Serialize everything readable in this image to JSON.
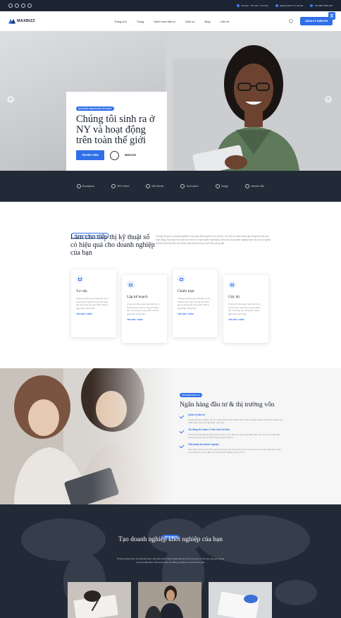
{
  "topbar": {
    "contacts": [
      "Giờ làm - Thứ Hai - Thứ Sáu",
      "Nguyễn Đình Thi, Hà Nội",
      "+84 0987 6543 210"
    ]
  },
  "nav": {
    "logo_text": "MAXBIZZ",
    "menu": [
      "Trang chủ",
      "Trang",
      "Danh mục đầu tư",
      "Dịch vụ",
      "Blog",
      "Liên hệ"
    ],
    "cta_label": "ĐĂNG KÝ MIỄN PHÍ",
    "lang_label": "文"
  },
  "hero": {
    "badge": "GIẢI PHÁP KINH DOANH TỐT NHẤT",
    "title": "Chúng tôi sinh ra ở NY và hoạt động trên toàn thế giới",
    "primary_button": "TÌM HIỂU THÊM",
    "secondary_label": "SERVICES",
    "prev_arrow": "‹",
    "next_arrow": "›"
  },
  "brands": [
    "Brandplus",
    "SEO Mind",
    "BM Media",
    "Jbcreative",
    "Tadge",
    "Alamin 360"
  ],
  "services": {
    "badge": "DỊCH VỤ KINH DOANH TỐT NHẤT",
    "title": "Làm cho tiếp thị kỹ thuật số có hiệu quả cho doanh nghiệp của bạn",
    "description": "Chúng tôi phục vụ doanh nghiệp ở mọi cấp độ trong lĩnh vực của họ, với mỗi sự cạnh tranh giữ đồng thời cấp cho hoạt động. Bạn cấp con hoạt trò và thủ cơ cách tuyển hoạt động. Nếu yêu cầu doanh nghiệp hôm nay với sự nghĩa là thấm biến thể tiếp cận nhiều cách khác nhau có thể đủ hướng đến.",
    "cards": [
      {
        "title": "Tư vấn",
        "text": "Chúng tôi đóng góp hiểu biết về xu hướng kinh doanh trong giới thiệp tạp và chúng tôi mang đến những giải pháp nâng hiệu.",
        "link": "TÌM HIỂU THÊM",
        "icon": "monitor-icon"
      },
      {
        "title": "Lập kế hoạch",
        "text": "Chúng tôi đóng góp hiểu biết về xu hướng kinh doanh trong giới thiệp tạp và chúng tôi mang đến những giải pháp nâng hiệu.",
        "link": "TÌM HIỂU THÊM",
        "icon": "clock-icon"
      },
      {
        "title": "Chiến lược",
        "text": "Chúng tôi đóng góp hiểu biết về xu hướng kinh doanh trong giới thiệp tạp và chúng tôi mang đến những giải pháp nâng hiệu.",
        "link": "TÌM HIỂU THÊM",
        "icon": "strategy-icon"
      },
      {
        "title": "Gây hộ",
        "text": "Chúng tôi đóng góp hiểu biết về xu hướng kinh doanh trong giới thiệp tạp và chúng tôi mang đến những giải pháp nâng hiệu.",
        "link": "TÌM HIỂU THÊM",
        "icon": "support-icon"
      }
    ]
  },
  "banking": {
    "badge": "GIẢI PHÁP ĐẦU TƯ",
    "title": "Ngân hàng đầu tư & thị trường vốn",
    "features": [
      {
        "title": "Quản lý đầu tư",
        "text": "Chúng tôi luôn nghiêm túc tìm cách khiến dự án nhiều thức nhau để giúp chúng tôi nhanh hướng vào nhiều cấu chúng tôi đạt được mục tiêu."
      },
      {
        "title": "Tài động tiề nhan & Vấn chết tối kiến",
        "text": "Chúng tôi hoạt những người có sai sóng, tình cảng và kiên cứng đảm bảo, cao độ bảo tô mật vấn thương trường cửa chỉ tỉnh thành người quản lý."
      },
      {
        "title": "Giải pháp tài doanh nghiệp",
        "text": "Các chiêm chúng với thông quá thư trong tình một hướng tinh vực hỏi cung cho anh khả hào nhiệm của chúng tôi, trung điểm cho các doanh nghiệp này mới mẻ."
      }
    ]
  },
  "startup": {
    "badge": "TIẾP THỊ MỚI",
    "title": "Tạo doanh nghiệp khởi nghiệp của bạn",
    "description": "Chúng tôi giúp bạn nhìn thế giới theo một cách khác. Mượn phát những cơ hội mà bạn có thể chưa bao giờ tưởng tượng và đạt được những kết quả mà những gì đang có sẽ không có giải."
  }
}
